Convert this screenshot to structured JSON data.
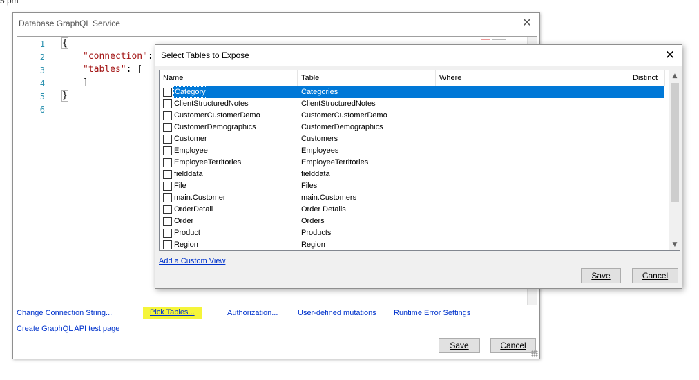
{
  "top_clip": "5 pm",
  "main_window": {
    "title": "Database GraphQL Service",
    "close_glyph": "✕",
    "editor": {
      "line_numbers": [
        "1",
        "2",
        "3",
        "4",
        "5",
        "6"
      ],
      "lines": {
        "l1": "{",
        "l2_key": "\"connection\"",
        "l2_rest": ":",
        "l3_key": "\"tables\"",
        "l3_rest": ": [",
        "l4": "]",
        "l5": "}"
      }
    },
    "links": {
      "change_connection": "Change Connection String...",
      "pick_tables": "Pick Tables...",
      "authorization": "Authorization...",
      "user_mutations": "User-defined mutations",
      "runtime_errors": "Runtime Error Settings",
      "create_test_page": "Create GraphQL API test page"
    },
    "save_label": "Save",
    "cancel_label": "Cancel"
  },
  "dialog": {
    "title": "Select Tables to Expose",
    "close_glyph": "✕",
    "columns": [
      "Name",
      "Table",
      "Where",
      "Distinct"
    ],
    "rows": [
      {
        "name": "Category",
        "table": "Categories"
      },
      {
        "name": "ClientStructuredNotes",
        "table": "ClientStructuredNotes"
      },
      {
        "name": "CustomerCustomerDemo",
        "table": "CustomerCustomerDemo"
      },
      {
        "name": "CustomerDemographics",
        "table": "CustomerDemographics"
      },
      {
        "name": "Customer",
        "table": "Customers"
      },
      {
        "name": "Employee",
        "table": "Employees"
      },
      {
        "name": "EmployeeTerritories",
        "table": "EmployeeTerritories"
      },
      {
        "name": "fielddata",
        "table": "fielddata"
      },
      {
        "name": "File",
        "table": "Files"
      },
      {
        "name": "main.Customer",
        "table": "main.Customers"
      },
      {
        "name": "OrderDetail",
        "table": "Order Details"
      },
      {
        "name": "Order",
        "table": "Orders"
      },
      {
        "name": "Product",
        "table": "Products"
      },
      {
        "name": "Region",
        "table": "Region"
      }
    ],
    "selected_row": "Category",
    "add_custom_view": "Add a Custom View",
    "save_label": "Save",
    "cancel_label": "Cancel"
  },
  "colors": {
    "selection": "#0078d7",
    "link": "#0033cc",
    "highlight": "#f5f53a",
    "line_number": "#2b91af",
    "string": "#a31515"
  }
}
